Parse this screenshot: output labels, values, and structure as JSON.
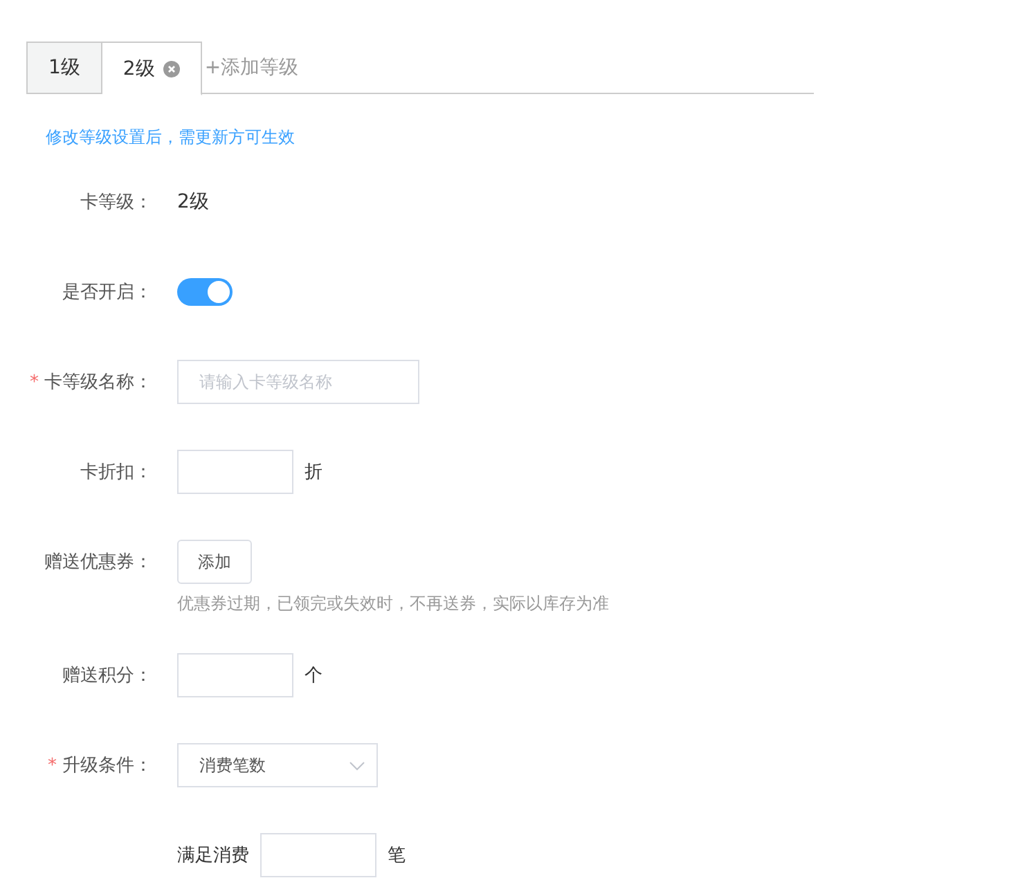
{
  "tabs": [
    {
      "label": "1级",
      "selected": false,
      "closable": false
    },
    {
      "label": "2级",
      "selected": true,
      "closable": true
    }
  ],
  "add_tab": "+添加等级",
  "notice": "修改等级设置后，需更新方可生效",
  "fields": [
    {
      "kind": "text",
      "label": "卡等级：",
      "value": "2级"
    },
    {
      "kind": "switch",
      "label": "是否开启：",
      "on": true
    },
    {
      "kind": "input",
      "label": "卡等级名称：",
      "required_mark": "*",
      "placeholder": "请输入卡等级名称"
    },
    {
      "kind": "input",
      "label": "卡折扣：",
      "suffix": "折"
    },
    {
      "kind": "button",
      "label": "赠送优惠券：",
      "button": "添加",
      "hint": "优惠券过期，已领完或失效时，不再送券，实际以库存为准"
    },
    {
      "kind": "input",
      "label": "赠送积分：",
      "suffix": "个"
    },
    {
      "kind": "select",
      "label": "升级条件：",
      "required_mark": "*",
      "value": "消费笔数"
    },
    {
      "kind": "inline",
      "prefix": "满足消费",
      "suffix": "笔"
    }
  ]
}
